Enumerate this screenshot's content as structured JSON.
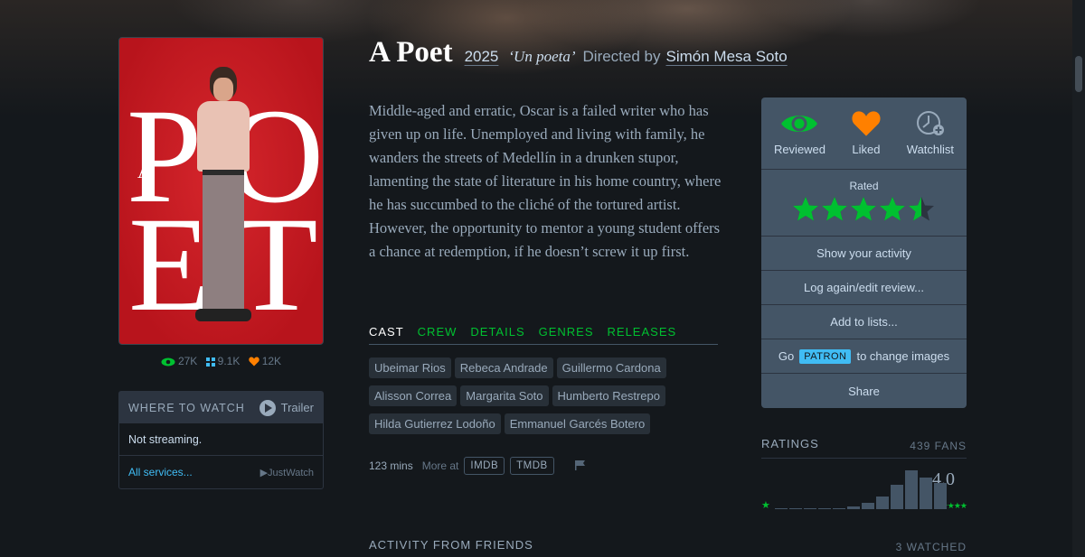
{
  "film": {
    "title": "A Poet",
    "year": "2025",
    "original_title": "‘Un poeta’",
    "directed_by": "Directed by",
    "director": "Simón Mesa Soto",
    "synopsis": "Middle-aged and erratic, Oscar is a failed writer who has given up on life. Unemployed and living with family, he wanders the streets of Medellín in a drunken stupor, lamenting the state of literature in his home country, where he has succumbed to the cliché of the tortured artist. However, the opportunity to mentor a young student offers a chance at redemption, if he doesn’t screw it up first."
  },
  "poster": {
    "letters": [
      "P",
      "O",
      "E",
      "T"
    ],
    "small_letter": "A",
    "stats": {
      "watched": "27K",
      "lists": "9.1K",
      "likes": "12K"
    }
  },
  "where_to_watch": {
    "title": "WHERE TO WATCH",
    "trailer": "Trailer",
    "status": "Not streaming.",
    "all_services": "All services...",
    "provider": "JustWatch"
  },
  "tabs": [
    {
      "label": "CAST",
      "active": true
    },
    {
      "label": "CREW",
      "active": false
    },
    {
      "label": "DETAILS",
      "active": false
    },
    {
      "label": "GENRES",
      "active": false
    },
    {
      "label": "RELEASES",
      "active": false
    }
  ],
  "cast": [
    "Ubeimar Rios",
    "Rebeca Andrade",
    "Guillermo Cardona",
    "Alisson Correa",
    "Margarita Soto",
    "Humberto Restrepo",
    "Hilda Gutierrez Lodoño",
    "Emmanuel Garcés Botero"
  ],
  "meta": {
    "runtime": "123 mins",
    "more_at": "More at",
    "imdb": "IMDB",
    "tmdb": "TMDB"
  },
  "actions": {
    "reviewed": "Reviewed",
    "liked": "Liked",
    "watchlist": "Watchlist",
    "rated_label": "Rated",
    "rating": 4.5,
    "show_activity": "Show your activity",
    "log_again": "Log again/edit review...",
    "add_to_lists": "Add to lists...",
    "go": "Go",
    "patron": "PATRON",
    "change_images": "to change images",
    "share": "Share"
  },
  "ratings": {
    "title": "RATINGS",
    "fans": "439 FANS",
    "average": "4.0",
    "histogram": [
      0.01,
      0.01,
      0.01,
      0.02,
      0.03,
      0.07,
      0.16,
      0.32,
      0.62,
      0.97,
      0.8,
      0.65
    ]
  },
  "friends": {
    "title": "ACTIVITY FROM FRIENDS",
    "watched": "3 WATCHED"
  },
  "colors": {
    "green": "#00c030",
    "orange": "#ff8000",
    "blue": "#40bcf4"
  }
}
